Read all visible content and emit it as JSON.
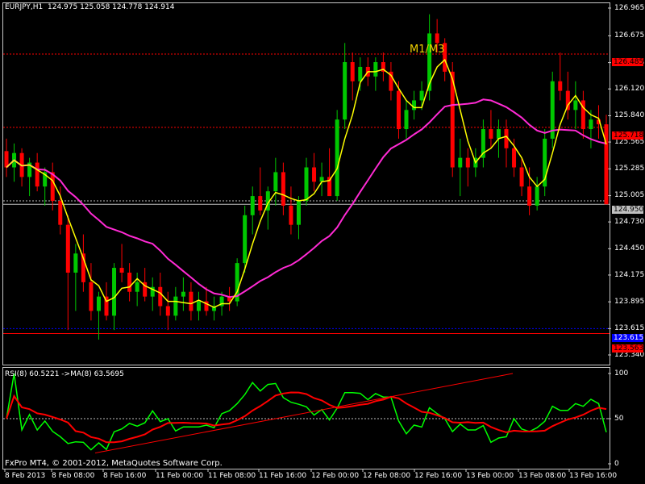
{
  "header": {
    "symbol": "EURJPY,H1",
    "ohlc": "124.975 125.058 124.778 124.914"
  },
  "annotation": {
    "m1m3": "M1/M3"
  },
  "rsi": {
    "header": "RSI(8) 60.5221   ->MA(8) 63.5695",
    "levels": [
      "100",
      "50",
      "0"
    ]
  },
  "copyright": "FxPro MT4, © 2001-2012, MetaQuotes Software Corp.",
  "price_axis": [
    "126.965",
    "126.675",
    "126.395",
    "126.120",
    "125.840",
    "125.565",
    "125.285",
    "125.005",
    "124.730",
    "124.450",
    "124.175",
    "123.895",
    "123.615",
    "123.340"
  ],
  "price_tags": {
    "red_top": "126.485",
    "red_mid": "125.718",
    "current": "124.950",
    "blue": "123.615",
    "red_bottom": "123.563"
  },
  "time_axis": [
    "8 Feb 2013",
    "8 Feb 08:00",
    "8 Feb 16:00",
    "11 Feb 00:00",
    "11 Feb 08:00",
    "11 Feb 16:00",
    "12 Feb 00:00",
    "12 Feb 08:00",
    "12 Feb 16:00",
    "13 Feb 00:00",
    "13 Feb 08:00",
    "13 Feb 16:00"
  ],
  "colors": {
    "bull": "#00c800",
    "bear": "#ff0000",
    "fast_ma": "#ffff00",
    "slow_ma": "#ff2ad4",
    "rsi": "#00ff00",
    "rsi_ma": "#ff0000",
    "level_red": "#ff0000",
    "level_blue": "#0000ff"
  },
  "chart_data": {
    "type": "candlestick",
    "symbol": "EURJPY",
    "timeframe": "H1",
    "ylim": [
      123.34,
      126.965
    ],
    "candles": [
      [
        125.47,
        125.6,
        125.2,
        125.3
      ],
      [
        125.3,
        125.55,
        125.15,
        125.45
      ],
      [
        125.45,
        125.5,
        125.1,
        125.2
      ],
      [
        125.2,
        125.4,
        125.0,
        125.35
      ],
      [
        125.35,
        125.45,
        125.05,
        125.1
      ],
      [
        125.1,
        125.3,
        124.9,
        125.25
      ],
      [
        125.25,
        125.35,
        124.85,
        124.95
      ],
      [
        124.95,
        125.1,
        124.6,
        124.7
      ],
      [
        124.7,
        124.8,
        123.6,
        124.2
      ],
      [
        124.2,
        124.5,
        123.8,
        124.4
      ],
      [
        124.4,
        124.6,
        124.0,
        124.1
      ],
      [
        124.1,
        124.3,
        123.7,
        123.8
      ],
      [
        123.8,
        124.0,
        123.5,
        123.95
      ],
      [
        123.95,
        124.1,
        123.7,
        123.75
      ],
      [
        123.75,
        124.3,
        123.6,
        124.25
      ],
      [
        124.25,
        124.5,
        124.1,
        124.2
      ],
      [
        124.2,
        124.3,
        123.9,
        124.0
      ],
      [
        124.0,
        124.2,
        123.85,
        124.1
      ],
      [
        124.1,
        124.25,
        123.9,
        123.95
      ],
      [
        123.95,
        124.15,
        123.8,
        124.05
      ],
      [
        124.05,
        124.2,
        123.75,
        123.85
      ],
      [
        123.85,
        124.0,
        123.6,
        123.75
      ],
      [
        123.75,
        124.05,
        123.7,
        123.95
      ],
      [
        123.95,
        124.15,
        123.8,
        124.0
      ],
      [
        124.0,
        124.1,
        123.7,
        123.8
      ],
      [
        123.8,
        124.0,
        123.7,
        123.9
      ],
      [
        123.9,
        124.05,
        123.75,
        123.8
      ],
      [
        123.8,
        123.95,
        123.7,
        123.85
      ],
      [
        123.85,
        124.0,
        123.75,
        123.95
      ],
      [
        123.95,
        124.05,
        123.8,
        123.9
      ],
      [
        123.9,
        124.35,
        123.85,
        124.3
      ],
      [
        124.3,
        124.9,
        124.2,
        124.8
      ],
      [
        124.8,
        125.1,
        124.6,
        125.0
      ],
      [
        125.0,
        125.3,
        124.8,
        124.85
      ],
      [
        124.85,
        125.1,
        124.65,
        125.05
      ],
      [
        125.05,
        125.4,
        124.9,
        125.25
      ],
      [
        125.25,
        125.35,
        124.8,
        124.9
      ],
      [
        124.9,
        125.1,
        124.6,
        124.7
      ],
      [
        124.7,
        125.0,
        124.55,
        124.95
      ],
      [
        124.95,
        125.4,
        124.9,
        125.3
      ],
      [
        125.3,
        125.45,
        125.05,
        125.15
      ],
      [
        125.15,
        125.35,
        125.0,
        125.2
      ],
      [
        125.2,
        125.5,
        125.1,
        125.0
      ],
      [
        125.0,
        125.9,
        124.95,
        125.8
      ],
      [
        125.8,
        126.6,
        125.7,
        126.4
      ],
      [
        126.4,
        126.5,
        126.0,
        126.2
      ],
      [
        126.2,
        126.45,
        126.1,
        126.35
      ],
      [
        126.35,
        126.45,
        126.15,
        126.25
      ],
      [
        126.25,
        126.45,
        126.1,
        126.4
      ],
      [
        126.4,
        126.5,
        126.2,
        126.3
      ],
      [
        126.3,
        126.4,
        126.0,
        126.1
      ],
      [
        126.1,
        126.2,
        125.6,
        125.7
      ],
      [
        125.7,
        126.0,
        125.6,
        125.9
      ],
      [
        125.9,
        126.1,
        125.8,
        126.0
      ],
      [
        126.0,
        126.2,
        125.9,
        126.1
      ],
      [
        126.1,
        126.9,
        126.0,
        126.7
      ],
      [
        126.7,
        126.85,
        126.5,
        126.6
      ],
      [
        126.6,
        126.65,
        126.2,
        126.3
      ],
      [
        126.3,
        126.4,
        125.2,
        125.3
      ],
      [
        125.3,
        125.6,
        125.0,
        125.4
      ],
      [
        125.4,
        125.5,
        125.1,
        125.3
      ],
      [
        125.3,
        125.5,
        125.2,
        125.4
      ],
      [
        125.4,
        125.8,
        125.3,
        125.7
      ],
      [
        125.7,
        125.9,
        125.5,
        125.6
      ],
      [
        125.6,
        125.8,
        125.4,
        125.7
      ],
      [
        125.7,
        125.8,
        125.3,
        125.5
      ],
      [
        125.5,
        125.6,
        125.2,
        125.3
      ],
      [
        125.3,
        125.4,
        125.0,
        125.1
      ],
      [
        125.1,
        125.3,
        124.8,
        124.9
      ],
      [
        124.9,
        125.2,
        124.85,
        125.1
      ],
      [
        125.1,
        125.7,
        125.0,
        125.6
      ],
      [
        125.6,
        126.3,
        125.5,
        126.2
      ],
      [
        126.2,
        126.5,
        126.0,
        126.1
      ],
      [
        126.1,
        126.3,
        125.8,
        125.9
      ],
      [
        125.9,
        126.2,
        125.7,
        126.0
      ],
      [
        126.0,
        126.1,
        125.6,
        125.7
      ],
      [
        125.7,
        125.9,
        125.5,
        125.8
      ],
      [
        125.8,
        125.95,
        125.6,
        125.75
      ],
      [
        125.75,
        125.85,
        125.6,
        124.914
      ]
    ],
    "rsi": {
      "period": 8,
      "value": 60.5221,
      "ma_period": 8,
      "ma_value": 63.5695,
      "levels": [
        100,
        50,
        0
      ]
    }
  }
}
